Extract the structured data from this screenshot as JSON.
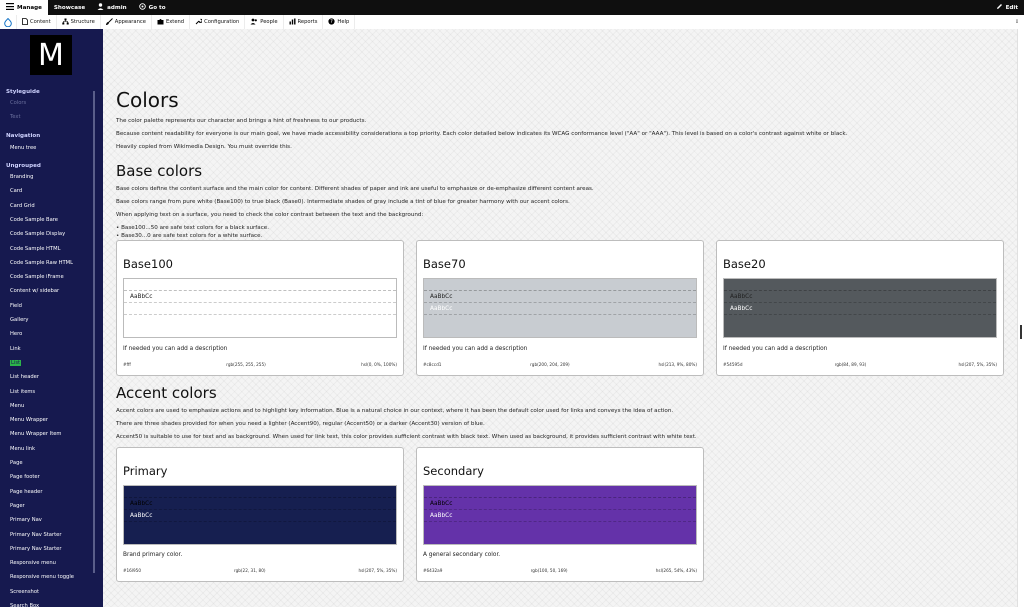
{
  "toolbar": {
    "manage": "Manage",
    "showcase": "Showcase",
    "user": "admin",
    "goto": "Go to",
    "edit": "Edit"
  },
  "tray": {
    "items": [
      "Content",
      "Structure",
      "Appearance",
      "Extend",
      "Configuration",
      "People",
      "Reports",
      "Help"
    ]
  },
  "sidebar": {
    "logo": "M",
    "styleguide": "Styleguide",
    "styleguide_items": [
      "Colors",
      "Text"
    ],
    "navigation": "Navigation",
    "navigation_items": [
      "Menu tree"
    ],
    "ungrouped": "Ungrouped",
    "ungrouped_items": [
      "Branding",
      "Card",
      "Card Grid",
      "Code Sample Bare",
      "Code Sample Display",
      "Code Sample HTML",
      "Code Sample Raw HTML",
      "Code Sample iFrame",
      "Content w/ sidebar",
      "Field",
      "Gallery",
      "Hero",
      "Link",
      "List",
      "List header",
      "List items",
      "Menu",
      "Menu Wrapper",
      "Menu Wrapper Item",
      "Menu link",
      "Page",
      "Page footer",
      "Page header",
      "Pager",
      "Primary Nav",
      "Primary Nav Starter",
      "Primary Nav Starter",
      "Responsive menu",
      "Responsive menu toggle",
      "Screenshot",
      "Search Box"
    ]
  },
  "page": {
    "title": "Colors",
    "intro": [
      "The color palette represents our character and brings a hint of freshness to our products.",
      "Because content readability for everyone is our main goal, we have made accessibility considerations a top priority. Each color detailed below indicates its WCAG conformance level (\"AA\" or \"AAA\"). This level is based on a color's contrast against white or black.",
      "Heavily copied from Wikimedia Design. You must override this."
    ],
    "base_title": "Base colors",
    "base_text": [
      "Base colors define the content surface and the main color for content. Different shades of paper and ink are useful to emphasize or de-emphasize different content areas.",
      "Base colors range from pure white (Base100) to true black (Base0). Intermediate shades of gray include a tint of blue for greater harmony with our accent colors.",
      "When applying text on a surface, you need to check the color contrast between the text and the background:"
    ],
    "base_bullets": [
      "Base100...50 are safe text colors for a black surface.",
      "Base30...0 are safe text colors for a white surface."
    ],
    "accent_title": "Accent colors",
    "accent_text": [
      "Accent colors are used to emphasize actions and to highlight key information. Blue is a natural choice in our context, where it has been the default color used for links and conveys the idea of action.",
      "There are three shades provided for when you need a lighter (Accent90), regular (Accent50) or a darker (Accent30) version of blue.",
      "Accent50 is suitable to use for text and as background. When used for link text, this color provides sufficient contrast with black text. When used as background, it provides sufficient contrast with white text."
    ]
  },
  "cards": [
    {
      "title": "Base100",
      "sample": "AaBbCc",
      "sample2": "",
      "desc": "If needed you can add a description",
      "hex": "#fff",
      "rgb": "rgb(255, 255, 255)",
      "hsl": "hsl(0, 0%, 100%)",
      "color": "#ffffff"
    },
    {
      "title": "Base70",
      "sample": "AaBbCc",
      "sample2": "AaBbCc",
      "desc": "If needed you can add a description",
      "hex": "#c8ccd1",
      "rgb": "rgb(200, 204, 209)",
      "hsl": "hsl(213, 9%, 80%)",
      "color": "#c8ccd1"
    },
    {
      "title": "Base20",
      "sample": "AaBbCc",
      "sample2": "AaBbCc",
      "desc": "If needed you can add a description",
      "hex": "#54595d",
      "rgb": "rgb(84, 89, 93)",
      "hsl": "hsl(207, 5%, 35%)",
      "color": "#54595d"
    },
    {
      "title": "Primary",
      "sample": "AaBbCc",
      "sample2": "AaBbCc",
      "desc": "Brand primary color.",
      "hex": "#16l950",
      "rgb": "rgb(22, 31, 80)",
      "hsl": "hsl(207, 5%, 35%)",
      "color": "#161f50"
    },
    {
      "title": "Secondary",
      "sample": "AaBbCc",
      "sample2": "AaBbCc",
      "desc": "A general secondary color.",
      "hex": "#6432a9",
      "rgb": "rgb(100, 50, 169)",
      "hsl": "hsl(265, 54%, 43%)",
      "color": "#6432a9"
    }
  ]
}
